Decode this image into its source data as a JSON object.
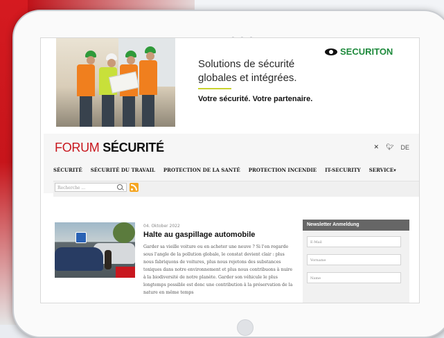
{
  "banner": {
    "headline_line1": "Solutions de sécurité",
    "headline_line2": "globales et intégrées.",
    "tagline": "Votre sécurité. Votre partenaire.",
    "logo_text": "SECURITON"
  },
  "site": {
    "logo_part1": "FORUM",
    "logo_part2": "SÉCURITÉ",
    "lang": "DE"
  },
  "nav": {
    "items": [
      "SÉCURITÉ",
      "SÉCURITÉ DU TRAVAIL",
      "PROTECTION DE LA SANTÉ",
      "PROTECTION INCENDIE",
      "IT-SECURITY",
      "SERVICE▾"
    ]
  },
  "search": {
    "placeholder": "Recherche ..."
  },
  "article": {
    "date": "04. Oktober 2022",
    "title": "Halte au gaspillage automobile",
    "excerpt": "Garder sa vieille voiture ou en acheter une neuve ? Si l'on regarde sous l'angle de la pollution globale, le constat devient clair : plus nous fabriquons de voitures, plus nous rejetons des substances toxiques dans notre environnement et plus nous contribuons à nuire à la biodiversité de notre planète. Garder son véhicule le plus longtemps possible est donc une contribution à la préservation de la nature en même temps"
  },
  "newsletter": {
    "title": "Newsletter Anmeldung",
    "fields": [
      "E-Mail",
      "Vorname",
      "Name"
    ]
  },
  "colors": {
    "brand_red": "#c8171e",
    "securiton_green": "#1e8a3c",
    "accent_lime": "#c9d22e"
  }
}
